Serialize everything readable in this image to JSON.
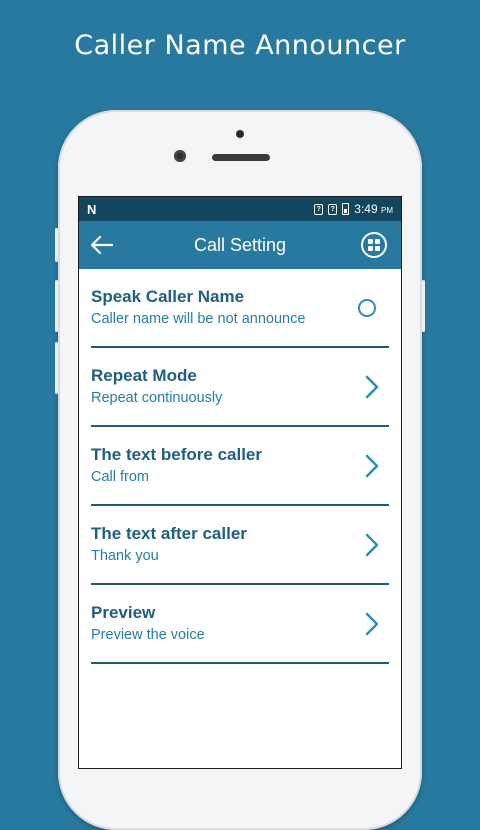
{
  "promo": {
    "title": "Caller Name Announcer"
  },
  "status_bar": {
    "left_glyph": "N",
    "sim1": "?",
    "sim2": "?",
    "time": "3:49",
    "ampm": "PM"
  },
  "app_bar": {
    "title": "Call Setting",
    "back_icon": "arrow-left-icon",
    "menu_icon": "grid-icon"
  },
  "settings": [
    {
      "title": "Speak Caller Name",
      "subtitle": "Caller name will be not announce",
      "control": "toggle",
      "toggle_on": false
    },
    {
      "title": "Repeat Mode",
      "subtitle": "Repeat continuously",
      "control": "chevron"
    },
    {
      "title": "The text before caller",
      "subtitle": "Call from",
      "control": "chevron"
    },
    {
      "title": "The text after caller",
      "subtitle": "Thank you",
      "control": "chevron"
    },
    {
      "title": "Preview",
      "subtitle": "Preview the voice",
      "control": "chevron"
    }
  ],
  "colors": {
    "background": "#28799f",
    "status_bar": "#12465f",
    "app_bar": "#28799f",
    "item_title": "#1f5f80",
    "item_subtitle": "#257ea6",
    "divider": "#1f5b79",
    "accent": "#2a8fb8"
  }
}
